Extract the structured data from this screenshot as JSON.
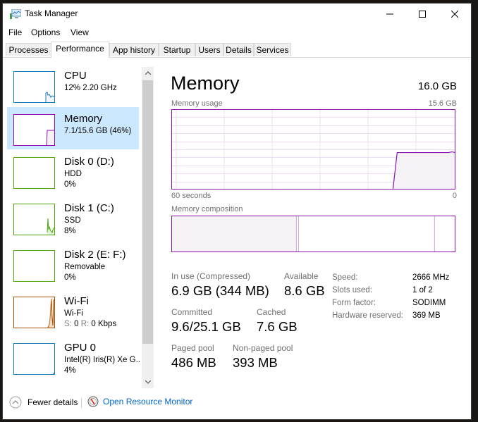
{
  "window": {
    "title": "Task Manager",
    "controls": {
      "minimize": "minimize",
      "maximize": "maximize",
      "close": "close"
    }
  },
  "menu": [
    "File",
    "Options",
    "View"
  ],
  "tabs": [
    {
      "label": "Processes",
      "active": false
    },
    {
      "label": "Performance",
      "active": true
    },
    {
      "label": "App history",
      "active": false
    },
    {
      "label": "Startup",
      "active": false
    },
    {
      "label": "Users",
      "active": false
    },
    {
      "label": "Details",
      "active": false
    },
    {
      "label": "Services",
      "active": false
    }
  ],
  "sidebar": {
    "items": [
      {
        "name": "CPU",
        "line1": "12% 2.20 GHz",
        "line2": "",
        "color": "#1c7ab6",
        "selected": false
      },
      {
        "name": "Memory",
        "line1": "7.1/15.6 GB (46%)",
        "line2": "",
        "color": "#8b12ae",
        "selected": true
      },
      {
        "name": "Disk 0 (D:)",
        "line1": "HDD",
        "line2": "0%",
        "color": "#4da60c",
        "selected": false
      },
      {
        "name": "Disk 1 (C:)",
        "line1": "SSD",
        "line2": "8%",
        "color": "#4da60c",
        "selected": false
      },
      {
        "name": "Disk 2 (E: F:)",
        "line1": "Removable",
        "line2": "0%",
        "color": "#4da60c",
        "selected": false
      },
      {
        "name": "Wi-Fi",
        "line1": "Wi-Fi",
        "line2_s_label": "S:",
        "line2_s_value": "0",
        "line2_r_label": "R:",
        "line2_r_value": "0 Kbps",
        "color": "#a74f01",
        "selected": false
      },
      {
        "name": "GPU 0",
        "line1": "Intel(R) Iris(R) Xe G...",
        "line2": "4%",
        "color": "#1c7ab6",
        "selected": false
      }
    ]
  },
  "main": {
    "title": "Memory",
    "total": "16.0 GB",
    "usage_label": "Memory usage",
    "usage_max": "15.6 GB",
    "time_left": "60 seconds",
    "time_right": "0",
    "composition_label": "Memory composition",
    "composition": {
      "in_use_fraction": 0.44,
      "modified_fraction": 0.005,
      "standby_fraction": 0.48,
      "free_fraction": 0.065
    },
    "usage_history_percent": {
      "start_fraction_of_window": 0.78,
      "level_percent": 46
    },
    "accent_color": "#8b12ae",
    "stats": {
      "in_use_label": "In use (Compressed)",
      "in_use_value": "6.9 GB (344 MB)",
      "available_label": "Available",
      "available_value": "8.6 GB",
      "committed_label": "Committed",
      "committed_value": "9.6/25.1 GB",
      "cached_label": "Cached",
      "cached_value": "7.6 GB",
      "paged_label": "Paged pool",
      "paged_value": "486 MB",
      "nonpaged_label": "Non-paged pool",
      "nonpaged_value": "393 MB"
    },
    "specs": [
      {
        "label": "Speed:",
        "value": "2666 MHz"
      },
      {
        "label": "Slots used:",
        "value": "1 of 2"
      },
      {
        "label": "Form factor:",
        "value": "SODIMM"
      },
      {
        "label": "Hardware reserved:",
        "value": "369 MB"
      }
    ]
  },
  "footer": {
    "fewer_details": "Fewer details",
    "open_resource_monitor": "Open Resource Monitor",
    "link_color": "#0066cc"
  }
}
